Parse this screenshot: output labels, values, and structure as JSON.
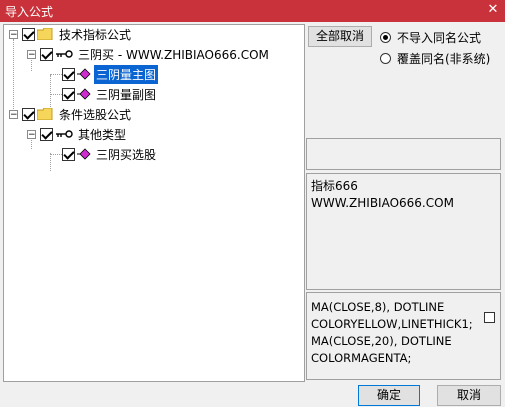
{
  "window": {
    "title": "导入公式",
    "close_glyph": "✕"
  },
  "tree": {
    "group1": {
      "label": "技术指标公式",
      "child": {
        "label": "三阴买 - WWW.ZHIBIAO666.COM",
        "items": [
          {
            "label": "三阴量主图",
            "selected": true
          },
          {
            "label": "三阴量副图",
            "selected": false
          }
        ]
      }
    },
    "group2": {
      "label": "条件选股公式",
      "child": {
        "label": "其他类型",
        "items": [
          {
            "label": "三阴买选股",
            "selected": false
          }
        ]
      }
    },
    "expander_glyph": "−"
  },
  "controls": {
    "cancel_all_label": "全部取消",
    "radio_skip_label": "不导入同名公式",
    "radio_overwrite_label": "覆盖同名(非系统)",
    "radio_selected": "skip"
  },
  "description": {
    "line1": "指标666",
    "line2": "WWW.ZHIBIAO666.COM"
  },
  "code": {
    "lines": [
      "MA(CLOSE,8), DOTLINE",
      "COLORYELLOW,LINETHICK1;",
      "MA(CLOSE,20), DOTLINE",
      "COLORMAGENTA;"
    ]
  },
  "buttons": {
    "ok_label": "确定",
    "cancel_label": "取消"
  },
  "colors": {
    "titlebar": "#c9323a",
    "selection": "#0a64d2",
    "folder": "#f5d55a",
    "diamond": "#d02bd0"
  }
}
